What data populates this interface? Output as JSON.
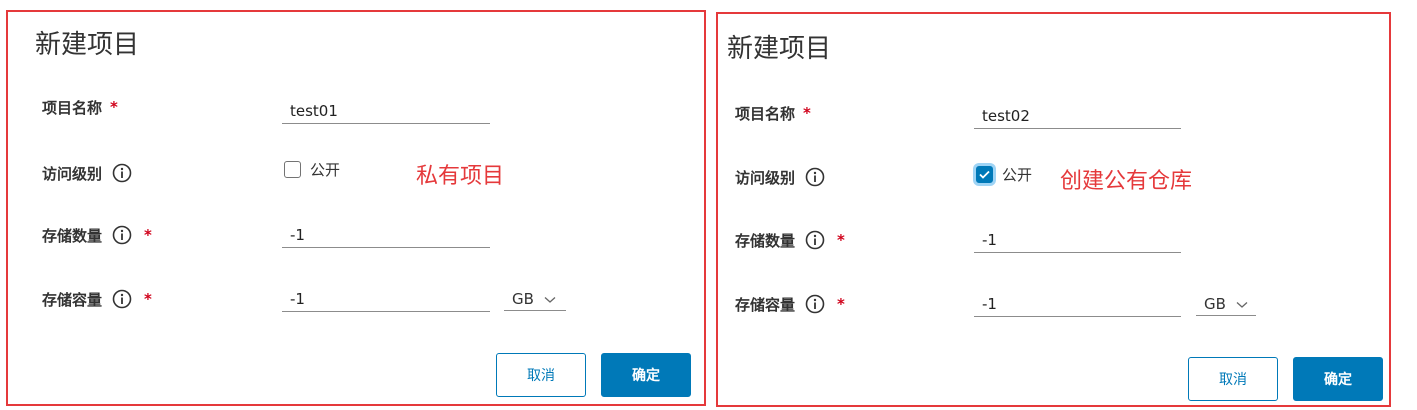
{
  "left_dialog": {
    "title": "新建项目",
    "project_name": {
      "label": "项目名称",
      "required_mark": "*",
      "value": "test01"
    },
    "access_level": {
      "label": "访问级别",
      "checkbox_label": "公开",
      "checked": false
    },
    "annotation": "私有项目",
    "storage_count": {
      "label": "存储数量",
      "required_mark": "*",
      "value": "-1"
    },
    "storage_capacity": {
      "label": "存储容量",
      "required_mark": "*",
      "value": "-1",
      "unit": "GB"
    },
    "cancel_label": "取消",
    "confirm_label": "确定"
  },
  "right_dialog": {
    "title": "新建项目",
    "project_name": {
      "label": "项目名称",
      "required_mark": "*",
      "value": "test02"
    },
    "access_level": {
      "label": "访问级别",
      "checkbox_label": "公开",
      "checked": true
    },
    "annotation": "创建公有仓库",
    "storage_count": {
      "label": "存储数量",
      "required_mark": "*",
      "value": "-1"
    },
    "storage_capacity": {
      "label": "存储容量",
      "required_mark": "*",
      "value": "-1",
      "unit": "GB"
    },
    "cancel_label": "取消",
    "confirm_label": "确定"
  },
  "colors": {
    "accent": "#0079b8",
    "annotation_red": "#e5393b",
    "required_red": "#d0021b"
  },
  "icons": {
    "info": "info-circle-icon",
    "check": "check-icon",
    "chevron": "chevron-down-icon"
  }
}
